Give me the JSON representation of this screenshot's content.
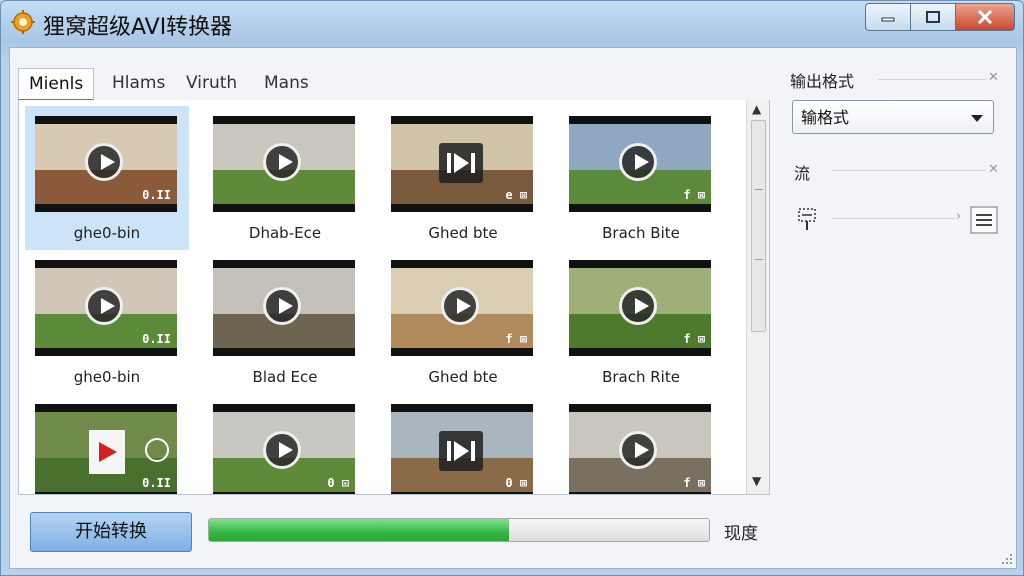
{
  "window": {
    "title": "狸窝超级AVI转换器"
  },
  "tabs": [
    {
      "label": "Mienls",
      "active": true
    },
    {
      "label": "Hlams"
    },
    {
      "label": "Viruth"
    },
    {
      "label": "Mans"
    }
  ],
  "videos": [
    {
      "caption": "ghe0-bin",
      "badge": "0.II",
      "selected": true,
      "wall": "#d8c9b4",
      "floor": "#8a5a3a",
      "icon": "play"
    },
    {
      "caption": "Dhab-Ece",
      "badge": "",
      "wall": "#c9c6bd",
      "floor": "#5f8a3a",
      "icon": "play"
    },
    {
      "caption": "Ghed bte",
      "badge": "e ⊠",
      "wall": "#d2c4a8",
      "floor": "#7a5a3c",
      "icon": "skip"
    },
    {
      "caption": "Brach Bite",
      "badge": "f ⊠",
      "wall": "#8fa7c0",
      "floor": "#5a8a3a",
      "icon": "play"
    },
    {
      "caption": "ghe0-bin",
      "badge": "0.II",
      "wall": "#cfc6b8",
      "floor": "#5b8a38",
      "icon": "play"
    },
    {
      "caption": "Blad Ece",
      "badge": "",
      "wall": "#c4c1bb",
      "floor": "#6d6552",
      "icon": "play"
    },
    {
      "caption": "Ghed bte",
      "badge": "f ⊠",
      "wall": "#d9cdb4",
      "floor": "#b08a5a",
      "icon": "play"
    },
    {
      "caption": "Brach Rite",
      "badge": "f ⊠",
      "wall": "#9db07a",
      "floor": "#4f7a2e",
      "icon": "play"
    },
    {
      "caption": "",
      "badge": "0.II",
      "wall": "#6f8a4a",
      "floor": "#4a7030",
      "icon": "redplay"
    },
    {
      "caption": "",
      "badge": "0 ⊡",
      "wall": "#c8c6c0",
      "floor": "#5f8a3a",
      "icon": "play"
    },
    {
      "caption": "",
      "badge": "0 ⊠",
      "wall": "#a9b6bf",
      "floor": "#8a6a48",
      "icon": "skip"
    },
    {
      "caption": "",
      "badge": "f ⊠",
      "wall": "#c9c6bd",
      "floor": "#7a7060",
      "icon": "play"
    }
  ],
  "side": {
    "format_label": "输出格式",
    "format_value": "输格式",
    "stream_label": "流"
  },
  "actions": {
    "start_label": "开始转换",
    "progress": 0.6,
    "progress_label": "现度"
  }
}
